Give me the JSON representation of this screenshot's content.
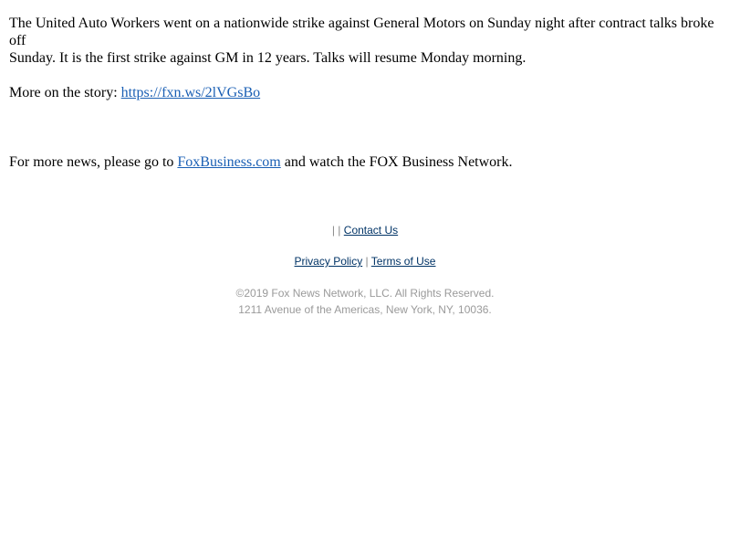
{
  "article": {
    "line1": "The United Auto Workers went on a nationwide strike against General Motors on Sunday night after contract talks broke off",
    "line2": "Sunday. It is the first strike against GM in 12 years. Talks will resume Monday morning.",
    "story_prefix": "More on the story: ",
    "story_link": "https://fxn.ws/2lVGsBo",
    "more_prefix": "For more news, please go to ",
    "more_link": "FoxBusiness.com",
    "more_suffix": " and watch the FOX Business Network."
  },
  "footer": {
    "top_separators": "| |",
    "contact_us": "Contact Us",
    "privacy_policy": "Privacy Policy",
    "mid_separator": "|",
    "terms_of_use": "Terms of Use",
    "copyright": "©2019 Fox News Network, LLC. All Rights Reserved.",
    "address": "1211 Avenue of the Americas, New York, NY, 10036."
  },
  "colors": {
    "link": "#1a5fb4",
    "footer_link": "#003366",
    "footer_muted": "#9a9a9a"
  }
}
